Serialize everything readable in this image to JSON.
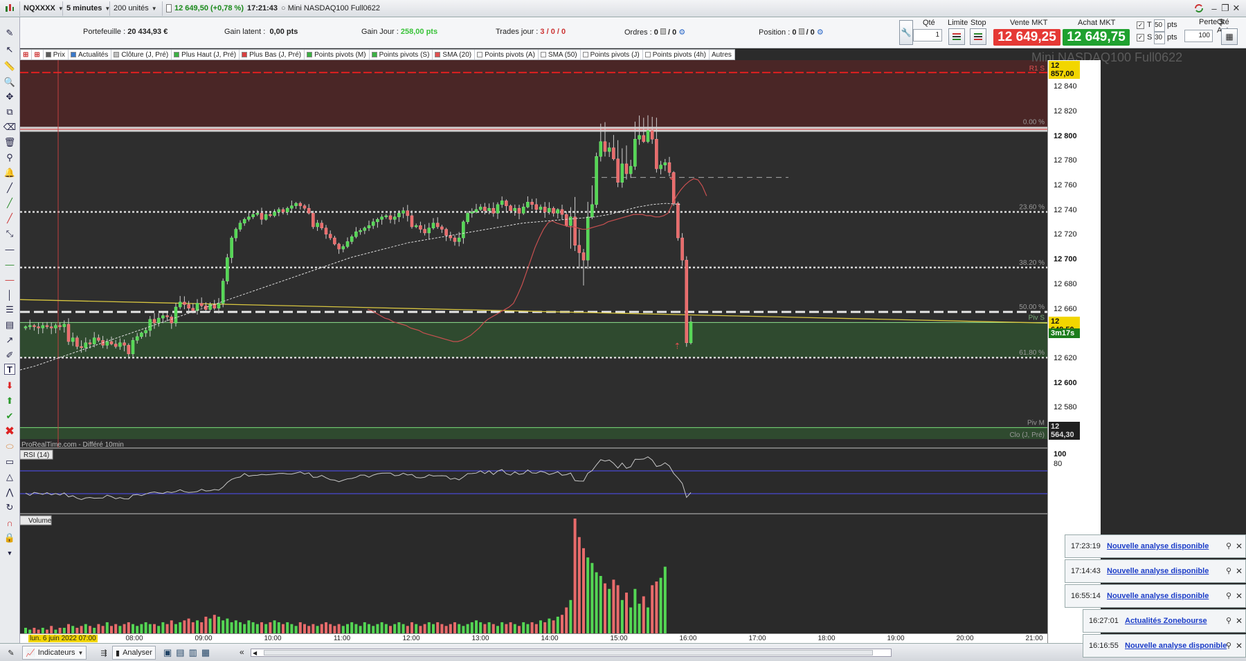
{
  "topbar": {
    "symbol": "NQXXXX",
    "timeframe": "5 minutes",
    "units": "200 unités",
    "last_price": "12 649,50 (+0,78 %)",
    "time": "17:21:43",
    "instrument": "Mini NASDAQ100 Full0622"
  },
  "info": {
    "portfolio_label": "Portefeuille :",
    "portfolio_value": "20 434,93 €",
    "latent_label": "Gain latent :",
    "latent_value": "0,00 pts",
    "day_label": "Gain Jour :",
    "day_value": "258,00 pts",
    "trades_label": "Trades jour :",
    "trades_value": "3 / 0 / 0",
    "orders_label": "Ordres :",
    "orders_value": "0",
    "orders_value2": "/ 0",
    "position_label": "Position :",
    "position_value": "0",
    "position_value2": "/ 0"
  },
  "trade": {
    "qty_label": "Qté",
    "qty_value": "1",
    "limit_label": "Limite",
    "stop_label": "Stop",
    "sell_label": "Vente MKT",
    "sell_price": "12 649,25",
    "buy_label": "Achat MKT",
    "buy_price": "12 649,75",
    "t_label": "T",
    "t_value": "50",
    "s_label": "S",
    "s_value": "30",
    "pts": "pts",
    "loss_label": "Perte $",
    "auto_qty_label": "Qté Auto",
    "auto_qty_value": "100",
    "sell_color": "#e53935",
    "buy_color": "#1fa12f"
  },
  "tags": [
    {
      "label": "Prix",
      "color": "#5a5a5a"
    },
    {
      "label": "Actualités",
      "color": "#3a78c8"
    },
    {
      "label": "Clôture (J, Pré)",
      "color": "#bdbdbd"
    },
    {
      "label": "Plus Haut (J, Pré)",
      "color": "#3cb043"
    },
    {
      "label": "Plus Bas (J, Pré)",
      "color": "#d84040"
    },
    {
      "label": "Points pivots (M)",
      "color": "#3cb043"
    },
    {
      "label": "Points pivots (S)",
      "color": "#3cb043"
    },
    {
      "label": "SMA (20)",
      "color": "#e05050"
    },
    {
      "label": "Points pivots (A)",
      "color": "#ffffff"
    },
    {
      "label": "SMA (50)",
      "color": "#ffffff"
    },
    {
      "label": "Points pivots (J)",
      "color": "#ffffff"
    },
    {
      "label": "Points pivots (4h)",
      "color": "#ffffff"
    },
    {
      "label": "Autres",
      "color": ""
    }
  ],
  "chart_title": "Mini NASDAQ100 Full0622",
  "chart_data": {
    "type": "candlestick",
    "title": "Mini NASDAQ100 Full0622",
    "ylim": [
      12555,
      12862
    ],
    "y_ticks": [
      "12 840",
      "12 820",
      "12 800",
      "12 780",
      "12 760",
      "12 740",
      "12 720",
      "12 700",
      "12 680",
      "12 660",
      "12 620",
      "12 600",
      "12 580"
    ],
    "x_ticks": [
      "08:00",
      "09:00",
      "10:00",
      "11:00",
      "12:00",
      "13:00",
      "14:00",
      "15:00",
      "16:00",
      "17:00",
      "18:00",
      "19:00",
      "20:00",
      "21:00"
    ],
    "x_start_label": "lun. 6 juin 2022 07:00",
    "levels": {
      "R1_S": 12852,
      "pivot_M": 12564.3,
      "piv_S": 12649.5,
      "high_prev": 12806,
      "fib_0": 12808,
      "fib_23_6": 12739,
      "fib_38_2": 12694,
      "fib_50": 12658,
      "fib_61_8": 12621
    },
    "level_labels": {
      "R1_S": "R1 S",
      "fib_0": "0.00 %",
      "fib_23_6": "23.60 %",
      "fib_38_2": "38.20 %",
      "fib_50": "50.00 %",
      "fib_61_8": "61.80 %",
      "piv_S": "Piv S",
      "piv_M": "Piv M",
      "clo": "Clo (J, Pré)"
    },
    "price_badges": {
      "top": "12 857,00",
      "current": "12 649,50",
      "countdown": "3m17s",
      "bottom": "12 564,30"
    },
    "closes": [
      12646,
      12647,
      12646,
      12645,
      12647,
      12646,
      12645,
      12647,
      12646,
      12648,
      12634,
      12637,
      12630,
      12629,
      12633,
      12632,
      12637,
      12635,
      12631,
      12634,
      12632,
      12630,
      12633,
      12631,
      12624,
      12635,
      12638,
      12641,
      12643,
      12652,
      12649,
      12653,
      12655,
      12654,
      12649,
      12662,
      12666,
      12664,
      12661,
      12659,
      12665,
      12663,
      12660,
      12664,
      12661,
      12665,
      12683,
      12702,
      12718,
      12725,
      12730,
      12733,
      12735,
      12737,
      12738,
      12733,
      12737,
      12736,
      12739,
      12741,
      12739,
      12742,
      12744,
      12746,
      12744,
      12742,
      12738,
      12727,
      12730,
      12726,
      12721,
      12718,
      12713,
      12709,
      12711,
      12715,
      12719,
      12723,
      12724,
      12726,
      12728,
      12731,
      12733,
      12735,
      12736,
      12733,
      12735,
      12738,
      12740,
      12736,
      12727,
      12728,
      12725,
      12722,
      12726,
      12730,
      12727,
      12725,
      12720,
      12718,
      12715,
      12718,
      12731,
      12738,
      12739,
      12741,
      12743,
      12740,
      12742,
      12738,
      12745,
      12748,
      12744,
      12740,
      12742,
      12738,
      12743,
      12747,
      12745,
      12741,
      12743,
      12739,
      12742,
      12738,
      12741,
      12737,
      12728,
      12735,
      12712,
      12706,
      12700,
      12735,
      12745,
      12784,
      12796,
      12788,
      12791,
      12782,
      12763,
      12778,
      12770,
      12776,
      12798,
      12801,
      12796,
      12805,
      12798,
      12774,
      12777,
      12779,
      12771,
      12746,
      12718,
      12700,
      12633,
      12650
    ],
    "sma20": [
      12660,
      12659,
      12657,
      12655,
      12653,
      12652,
      12650,
      12649,
      12648,
      12647,
      12645,
      12644,
      12643,
      12641,
      12640,
      12639,
      12638,
      12637,
      12636,
      12635,
      12634,
      12634,
      12635,
      12637,
      12639,
      12642,
      12645,
      12649,
      12652,
      12654,
      12656,
      12658,
      12660,
      12662,
      12665,
      12672,
      12680,
      12690,
      12700,
      12710,
      12718,
      12725,
      12730,
      12732,
      12730,
      12729,
      12728,
      12727,
      12727,
      12726,
      12725,
      12725,
      12726,
      12727,
      12728,
      12729,
      12731,
      12732,
      12733,
      12734,
      12735,
      12736,
      12737,
      12737,
      12737,
      12736,
      12736,
      12735,
      12735,
      12736,
      12738,
      12745,
      12752,
      12757,
      12761,
      12764,
      12766,
      12765,
      12760,
      12752
    ],
    "sma50": [
      12611,
      12614,
      12618,
      12622,
      12626,
      12630,
      12634,
      12638,
      12642,
      12646,
      12650,
      12654,
      12658,
      12662,
      12666,
      12670,
      12674,
      12678,
      12682,
      12686,
      12690,
      12694,
      12698,
      12702,
      12705,
      12708,
      12711,
      12714,
      12716,
      12718,
      12720,
      12722,
      12724,
      12726,
      12728,
      12730,
      12731,
      12732,
      12733,
      12734,
      12735,
      12737,
      12740,
      12743,
      12745,
      12746,
      12745
    ],
    "rsi_label": "RSI (14)",
    "rsi_levels": [
      "100",
      "80"
    ],
    "volume_label": "Volume",
    "volumes": [
      3,
      2,
      3,
      2,
      3,
      2,
      4,
      2,
      3,
      3,
      5,
      4,
      3,
      4,
      5,
      4,
      3,
      5,
      4,
      6,
      4,
      5,
      4,
      5,
      6,
      5,
      4,
      5,
      6,
      5,
      5,
      4,
      6,
      5,
      7,
      5,
      6,
      7,
      8,
      6,
      7,
      6,
      9,
      8,
      10,
      9,
      7,
      8,
      6,
      7,
      6,
      5,
      7,
      6,
      5,
      6,
      5,
      6,
      7,
      6,
      5,
      6,
      5,
      4,
      6,
      5,
      4,
      5,
      4,
      5,
      6,
      5,
      4,
      5,
      4,
      5,
      6,
      5,
      4,
      6,
      5,
      4,
      5,
      6,
      5,
      4,
      5,
      6,
      5,
      4,
      6,
      5,
      4,
      5,
      6,
      5,
      6,
      5,
      4,
      5,
      6,
      5,
      4,
      5,
      6,
      7,
      6,
      5,
      6,
      5,
      4,
      6,
      5,
      6,
      5,
      4,
      6,
      5,
      6,
      5,
      7,
      6,
      8,
      7,
      9,
      10,
      14,
      18,
      62,
      52,
      46,
      41,
      38,
      33,
      31,
      27,
      24,
      29,
      26,
      18,
      22,
      14,
      24,
      16,
      20,
      14,
      26,
      28,
      30,
      36
    ]
  },
  "watermark": "ProRealTime.com - Différé 10min",
  "bottombar": {
    "indicators": "Indicateurs",
    "analyse": "Analyser"
  },
  "notifications": [
    {
      "time": "17:23:19",
      "text": "Nouvelle analyse disponible"
    },
    {
      "time": "17:14:43",
      "text": "Nouvelle analyse disponible"
    },
    {
      "time": "16:55:14",
      "text": "Nouvelle analyse disponible"
    },
    {
      "time": "16:27:01",
      "text": "Actualités Zonebourse"
    },
    {
      "time": "16:16:55",
      "text": "Nouvelle analyse disponible"
    }
  ],
  "icons": [
    "pencil-icon",
    "cursor-icon",
    "ruler-icon",
    "zoom-icon",
    "move-icon",
    "copy-icon",
    "eraser-icon",
    "trash-icon",
    "magnet-icon",
    "bell-icon",
    "line-icon",
    "trend-icon",
    "ray-icon",
    "channel-icon",
    "hline-icon",
    "vline-icon",
    "text-icon",
    "arrow-down-icon",
    "arrow-up-icon",
    "check-icon",
    "cross-icon"
  ]
}
